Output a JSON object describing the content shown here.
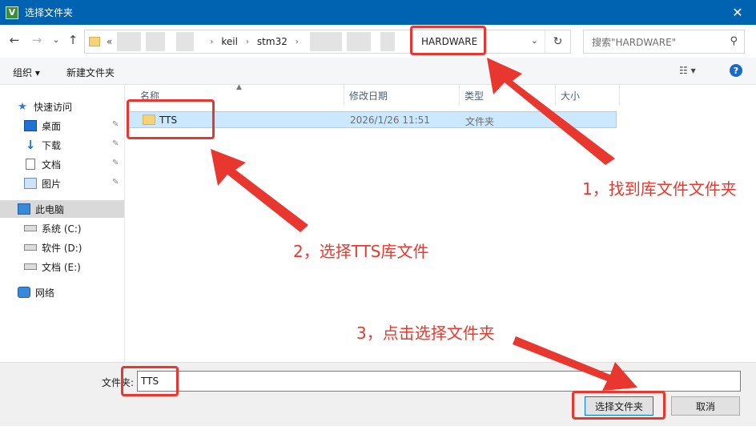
{
  "window": {
    "title": "选择文件夹",
    "app_icon": "V"
  },
  "nav": {
    "back": "←",
    "forward": "→",
    "recent": "⌄",
    "up": "↑"
  },
  "address": {
    "ellipsis": "«",
    "crumbs": [
      "keil",
      "stm32"
    ],
    "current": "HARDWARE",
    "dropdown": "⌄",
    "refresh": "↻"
  },
  "search": {
    "placeholder": "搜索\"HARDWARE\""
  },
  "toolbar": {
    "organize": "组织 ▾",
    "new_folder": "新建文件夹",
    "view": "☷ ▾",
    "help": "?"
  },
  "sidebar": {
    "quick_access": "快速访问",
    "desktop": "桌面",
    "downloads": "下载",
    "documents": "文档",
    "pictures": "图片",
    "this_pc": "此电脑",
    "drive_c": "系统 (C:)",
    "drive_d": "软件 (D:)",
    "drive_e": "文档 (E:)",
    "network": "网络"
  },
  "columns": {
    "name": "名称",
    "date": "修改日期",
    "type": "类型",
    "size": "大小"
  },
  "files": [
    {
      "name": "TTS",
      "date": "2026/1/26 11:51",
      "type": "文件夹"
    }
  ],
  "bottom": {
    "folder_label": "文件夹:",
    "folder_value": "TTS",
    "select_button": "选择文件夹",
    "cancel_button": "取消"
  },
  "annotations": {
    "step1": "1，找到库文件文件夹",
    "step2": "2，选择TTS库文件",
    "step3": "3，点击选择文件夹",
    "color": "#e8372e"
  },
  "colors": {
    "titlebar": "#0063b1",
    "selection": "#cce8ff",
    "accent": "#0078d7"
  }
}
